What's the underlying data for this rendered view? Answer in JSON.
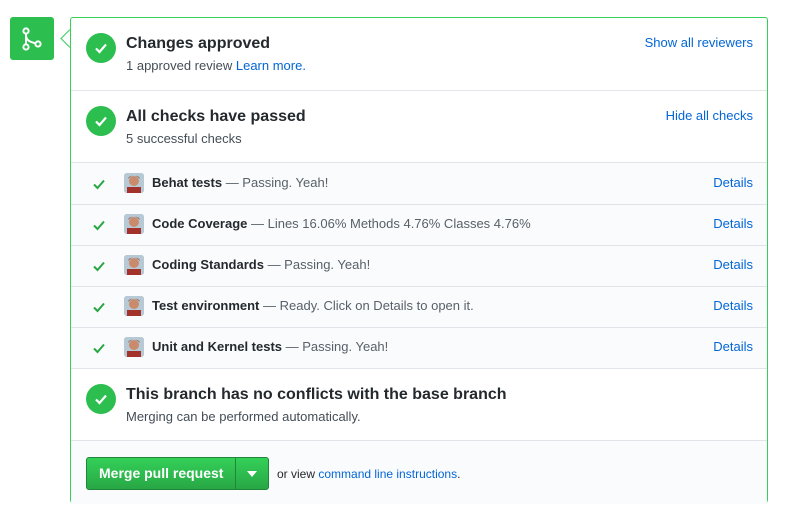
{
  "colors": {
    "success": "#2cbe4e",
    "link": "#0366d6",
    "border": "#34d058"
  },
  "icons": {
    "badge": "git-merge-icon",
    "status": "check-circle-icon",
    "row": "check-icon",
    "dropdown": "triangle-down-icon"
  },
  "approval": {
    "title": "Changes approved",
    "subtitle_prefix": "1 approved review",
    "learn_more": "Learn more.",
    "action": "Show all reviewers"
  },
  "checks_summary": {
    "title": "All checks have passed",
    "subtitle": "5 successful checks",
    "action": "Hide all checks"
  },
  "checks": [
    {
      "name": "Behat tests",
      "description": " — Passing. Yeah!",
      "details": "Details"
    },
    {
      "name": "Code Coverage",
      "description": " — Lines 16.06% Methods 4.76% Classes 4.76%",
      "details": "Details"
    },
    {
      "name": "Coding Standards",
      "description": " — Passing. Yeah!",
      "details": "Details"
    },
    {
      "name": "Test environment",
      "description": " — Ready. Click on Details to open it.",
      "details": "Details"
    },
    {
      "name": "Unit and Kernel tests",
      "description": " — Passing. Yeah!",
      "details": "Details"
    }
  ],
  "conflicts": {
    "title": "This branch has no conflicts with the base branch",
    "subtitle": "Merging can be performed automatically."
  },
  "footer": {
    "merge_label": "Merge pull request",
    "alt_prefix": "or view",
    "alt_link": "command line instructions",
    "alt_suffix": "."
  }
}
